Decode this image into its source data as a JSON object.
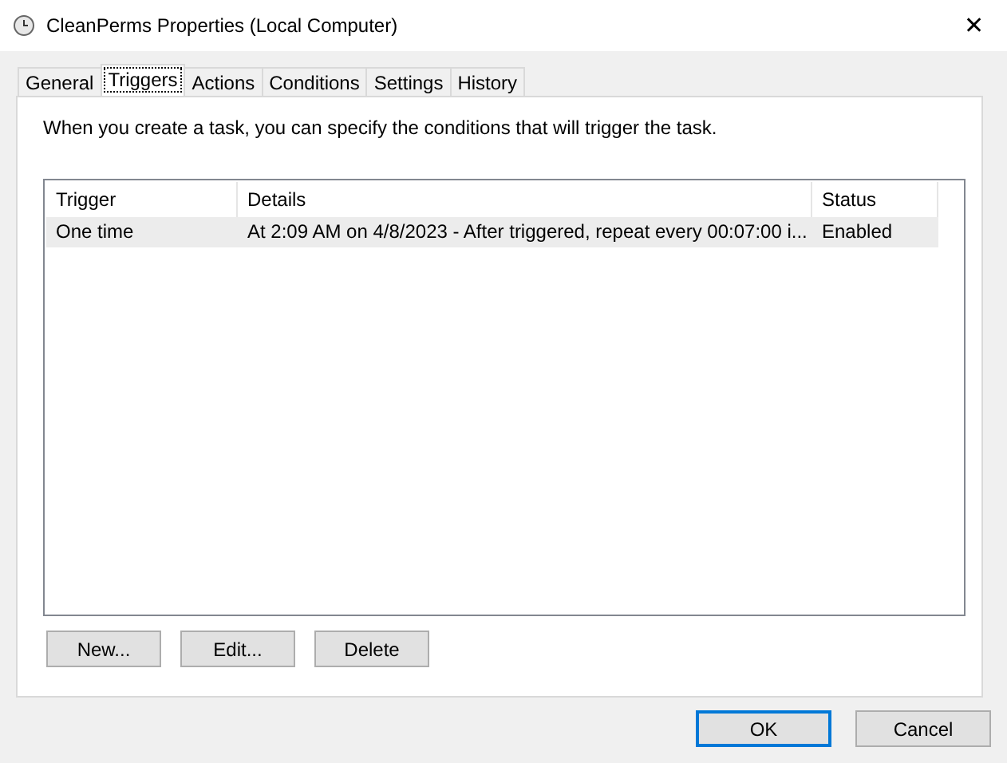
{
  "window": {
    "title": "CleanPerms Properties (Local Computer)",
    "close": "✕"
  },
  "tabs": [
    {
      "label": "General",
      "selected": false
    },
    {
      "label": "Triggers",
      "selected": true
    },
    {
      "label": "Actions",
      "selected": false
    },
    {
      "label": "Conditions",
      "selected": false
    },
    {
      "label": "Settings",
      "selected": false
    },
    {
      "label": "History",
      "selected": false
    }
  ],
  "description": "When you create a task, you can specify the conditions that will trigger the task.",
  "table": {
    "columns": [
      "Trigger",
      "Details",
      "Status"
    ],
    "rows": [
      {
        "cells": [
          "One time",
          "At 2:09 AM on 4/8/2023 - After triggered, repeat every 00:07:00 i...",
          "Enabled"
        ],
        "selected": true
      }
    ]
  },
  "actions": [
    "New...",
    "Edit...",
    "Delete"
  ],
  "footer": [
    {
      "label": "OK",
      "default": true
    },
    {
      "label": "Cancel",
      "default": false
    }
  ]
}
